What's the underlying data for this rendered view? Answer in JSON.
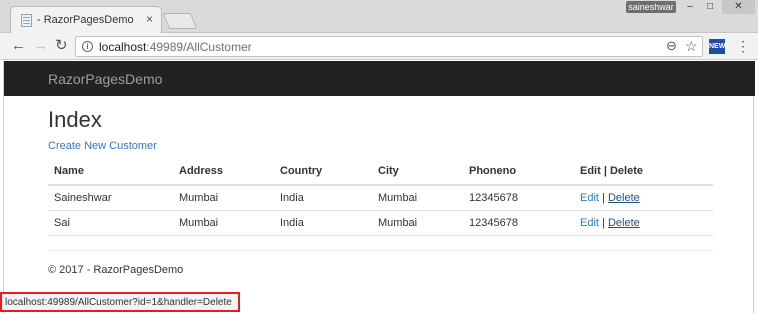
{
  "browser": {
    "tab_title": "- RazorPagesDemo",
    "tab_close": "×",
    "profile_name": "saineshwar",
    "window_controls": {
      "minimize": "–",
      "maximize": "□",
      "close": "✕"
    },
    "nav": {
      "back": "←",
      "forward": "→",
      "reload": "↻"
    },
    "url_host": "localhost",
    "url_path": ":49989/AllCustomer",
    "icons": [
      "info-icon",
      "zoom-icon",
      "star-icon",
      "extension-icon",
      "menu-icon"
    ],
    "extension_label": "NEW",
    "zoom_glyph": "⊖",
    "star_glyph": "☆",
    "menu_glyph": "⋮",
    "status_url": "localhost:49989/AllCustomer?id=1&handler=Delete"
  },
  "page": {
    "brand": "RazorPagesDemo",
    "heading": "Index",
    "create_link": "Create New Customer",
    "columns": [
      "Name",
      "Address",
      "Country",
      "City",
      "Phoneno",
      "Edit | Delete"
    ],
    "rows": [
      {
        "name": "Saineshwar",
        "address": "Mumbai",
        "country": "India",
        "city": "Mumbai",
        "phone": "12345678"
      },
      {
        "name": "Sai",
        "address": "Mumbai",
        "country": "India",
        "city": "Mumbai",
        "phone": "12345678"
      }
    ],
    "edit_label": "Edit",
    "separator": "|",
    "delete_label": "Delete",
    "footer": "© 2017 - RazorPagesDemo"
  },
  "colors": {
    "navbar": "#222222",
    "brand_text": "#9d9d9d",
    "link": "#337ab7",
    "status_highlight": "#e02020"
  }
}
